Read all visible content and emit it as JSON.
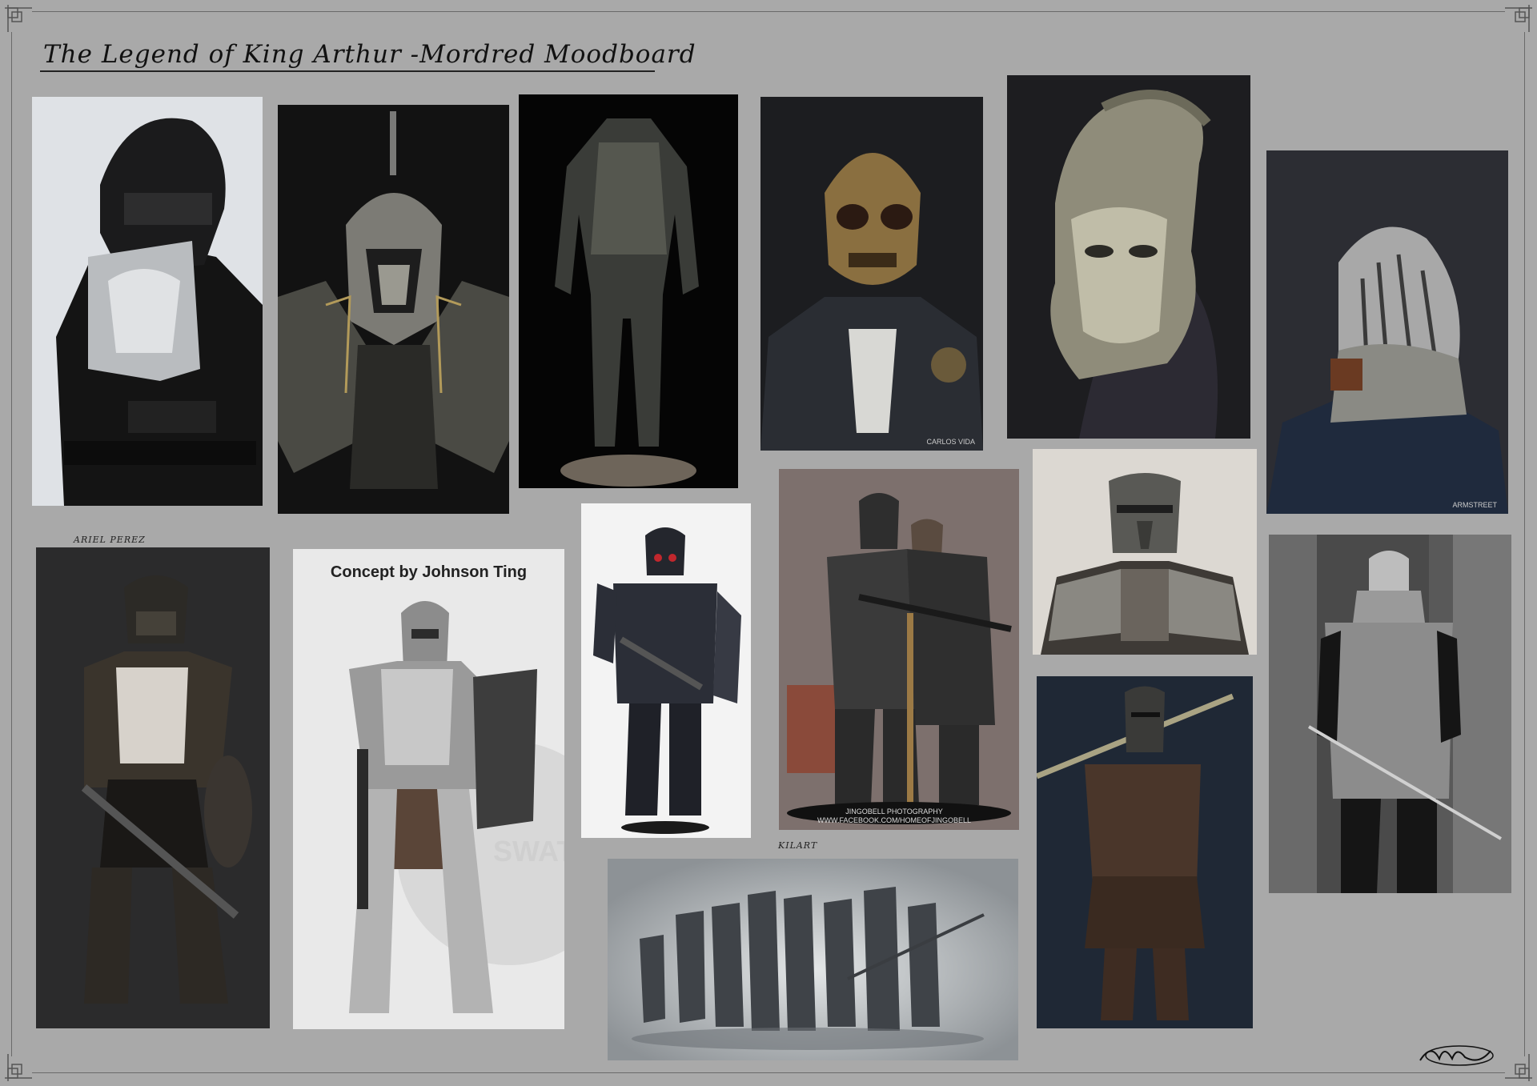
{
  "board": {
    "title": "The Legend of King Arthur -Mordred Moodboard",
    "background": "#a9a9a9"
  },
  "tiles": [
    {
      "id": "black-armor-wolf-chest",
      "icon": "armored-knight-icon"
    },
    {
      "id": "skull-helmet-bust",
      "icon": "skull-helmet-icon"
    },
    {
      "id": "dark-bodysuit-statue",
      "icon": "armored-figure-icon"
    },
    {
      "id": "gold-skull-mask",
      "icon": "skull-mask-icon",
      "credit": "CARLOS VIDA"
    },
    {
      "id": "bronze-face-helmet",
      "icon": "helmet-icon"
    },
    {
      "id": "tree-engraved-bascinet",
      "icon": "helmet-icon",
      "credit": "ARMSTREET"
    },
    {
      "id": "gladiator-concept",
      "icon": "armored-knight-icon",
      "credit": "ARIEL PEREZ"
    },
    {
      "id": "johnson-ting-concept",
      "icon": "armored-knight-icon",
      "caption": "Concept by Johnson Ting",
      "watermark": "SWAT"
    },
    {
      "id": "gas-mask-trooper",
      "icon": "soldier-icon"
    },
    {
      "id": "jingobell-figures",
      "icon": "soldier-icon",
      "credit": "JINGOBELL PHOTOGRAPHY",
      "credit_url": "WWW.FACEBOOK.COM/HOMEOFJINGOBELL"
    },
    {
      "id": "visored-bucket-helm",
      "icon": "helmet-icon"
    },
    {
      "id": "chainmail-knight",
      "icon": "armored-knight-icon"
    },
    {
      "id": "greatsword-knight",
      "icon": "armored-knight-icon"
    },
    {
      "id": "knight-squad-painting",
      "icon": "knight-squad-icon",
      "credit": "KILART"
    }
  ],
  "colors": {
    "dark_bg": "#111111",
    "metal": "#8a8a88",
    "bronze": "#9b8b62"
  }
}
